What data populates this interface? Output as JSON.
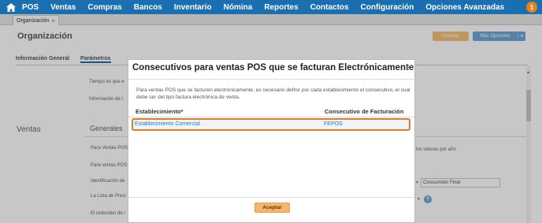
{
  "nav": {
    "items": [
      "POS",
      "Ventas",
      "Compras",
      "Bancos",
      "Inventario",
      "Nómina",
      "Reportes",
      "Contactos",
      "Configuración",
      "Opciones Avanzadas"
    ],
    "notification_count": "1",
    "bar_color": "#1a6fb0"
  },
  "tab": {
    "label": "Organización",
    "close": "×"
  },
  "page": {
    "title": "Organización",
    "save_label": "Guardar",
    "more_label": "Más Opciones",
    "subtabs": [
      "Información General",
      "Parámetros"
    ],
    "labels": {
      "tiempo": "Tiempo en que e",
      "informacion": "Información de l",
      "ventas_side": "Ventas",
      "generales": "Generales",
      "para_ventas_1": "Para Ventas POS",
      "para_ventas_2": "Para ventas POS",
      "identificacion": "Identificación de",
      "lista_precios": "La Lista de Preci",
      "redondeo": "El redondeo de l",
      "valores": "los valores por año"
    },
    "consumidor_final": "Consumidor Final"
  },
  "modal": {
    "title": "Consecutivos para ventas POS que se facturan Electrónicamente",
    "description": "Para ventas POS que se facturen electrónicamente, es necesario definir por cada establecimiento el consecutivo, el cual debe ser del tipo factura electrónica de venta.",
    "col_establecimiento": "Establecimiento*",
    "col_consecutivo": "Consecutivo de Facturación",
    "rows": [
      {
        "establecimiento": "Establecimiento Comercial",
        "consecutivo": "FEPOS"
      }
    ],
    "accept_label": "Aceptar",
    "close": "×"
  }
}
